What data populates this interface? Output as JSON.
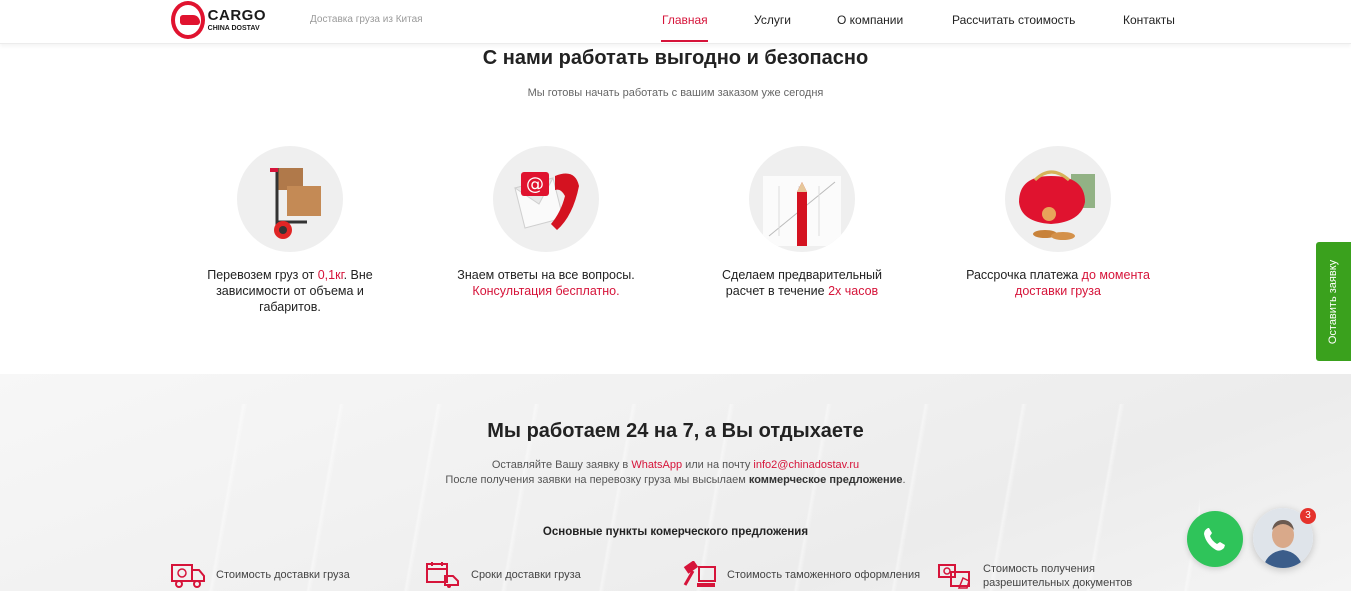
{
  "header": {
    "logo_main": "CARGO",
    "logo_sub": "CHINA DOSTAV",
    "tagline": "Доставка груза из Китая",
    "nav": [
      {
        "label": "Главная",
        "active": true
      },
      {
        "label": "Услуги",
        "active": false
      },
      {
        "label": "О компании",
        "active": false
      },
      {
        "label": "Рассчитать стоимость",
        "active": false
      },
      {
        "label": "Контакты",
        "active": false
      }
    ]
  },
  "section1": {
    "title": "С нами работать выгодно и безопасно",
    "subtitle": "Мы готовы начать работать с вашим заказом уже сегодня",
    "features": [
      {
        "icon": "hand-truck-boxes-icon",
        "text_pre": "Перевозем груз от ",
        "text_hl": "0,1кг",
        "text_post": ". Вне зависимости от объема и габаритов."
      },
      {
        "icon": "email-phone-icon",
        "text_pre": "Знаем ответы на все вопросы. ",
        "text_hl": "Консультация бесплатно.",
        "text_post": ""
      },
      {
        "icon": "pencil-chart-icon",
        "text_pre": "Сделаем предварительный расчет в течение ",
        "text_hl": "2х часов",
        "text_post": ""
      },
      {
        "icon": "purse-money-icon",
        "text_pre": "Рассрочка платежа ",
        "text_hl": "до момента доставки груза",
        "text_post": ""
      }
    ]
  },
  "section2": {
    "title": "Мы работаем 24 на 7, а Вы отдыхаете",
    "line1_pre": "Оставляйте Вашу заявку в ",
    "line1_whatsapp": "WhatsApp",
    "line1_mid": " или на почту ",
    "line1_email": "info2@chinadostav.ru",
    "line2_pre": "После получения заявки на перевозку груза мы высылаем ",
    "line2_bold": "коммерческое предложение",
    "line2_post": ".",
    "points_title": "Основные пункты комерческого предложения",
    "points": [
      {
        "icon": "truck-cost-icon",
        "label": "Стоимость доставки груза"
      },
      {
        "icon": "calendar-truck-icon",
        "label": "Сроки доставки груза"
      },
      {
        "icon": "customs-gavel-icon",
        "label": "Стоимость таможенного оформления"
      },
      {
        "icon": "documents-money-icon",
        "label": "Стоимость получения разрешительных документов"
      }
    ]
  },
  "side_tab": {
    "label": "Оставить заявку"
  },
  "chat": {
    "badge": "3"
  },
  "colors": {
    "accent": "#d6143a",
    "green": "#3aa11d",
    "whatsapp": "#2fc45a"
  }
}
